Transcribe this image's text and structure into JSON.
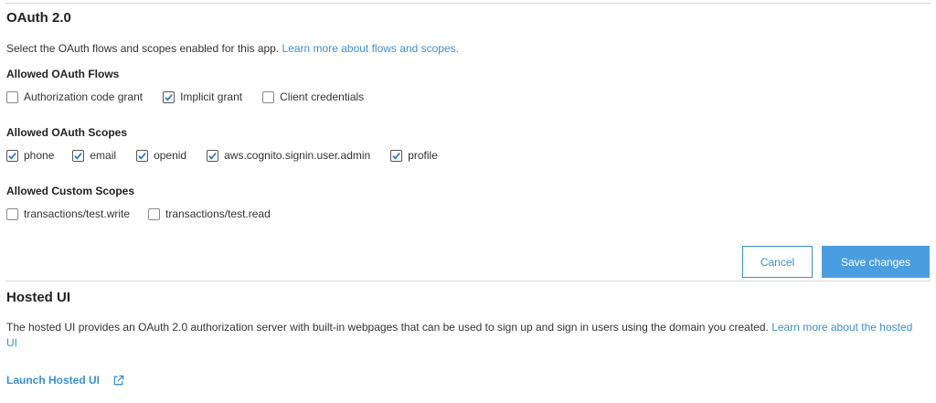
{
  "oauth": {
    "title": "OAuth 2.0",
    "description": "Select the OAuth flows and scopes enabled for this app.",
    "learn_more": "Learn more about flows and scopes.",
    "flows_label": "Allowed OAuth Flows",
    "flows": [
      {
        "label": "Authorization code grant",
        "checked": false
      },
      {
        "label": "Implicit grant",
        "checked": true
      },
      {
        "label": "Client credentials",
        "checked": false
      }
    ],
    "scopes_label": "Allowed OAuth Scopes",
    "scopes": [
      {
        "label": "phone",
        "checked": true
      },
      {
        "label": "email",
        "checked": true
      },
      {
        "label": "openid",
        "checked": true
      },
      {
        "label": "aws.cognito.signin.user.admin",
        "checked": true
      },
      {
        "label": "profile",
        "checked": true
      }
    ],
    "custom_label": "Allowed Custom Scopes",
    "custom_scopes": [
      {
        "label": "transactions/test.write",
        "checked": false
      },
      {
        "label": "transactions/test.read",
        "checked": false
      }
    ]
  },
  "actions": {
    "cancel_label": "Cancel",
    "save_label": "Save changes"
  },
  "hosted_ui": {
    "title": "Hosted UI",
    "description": "The hosted UI provides an OAuth 2.0 authorization server with built-in webpages that can be used to sign up and sign in users using the domain you created.",
    "learn_more": "Learn more about the hosted UI",
    "launch_label": "Launch Hosted UI",
    "launch_icon": "external-link-icon"
  },
  "colors": {
    "link": "#3a8fd4",
    "primary_button": "#4a9ee0"
  }
}
